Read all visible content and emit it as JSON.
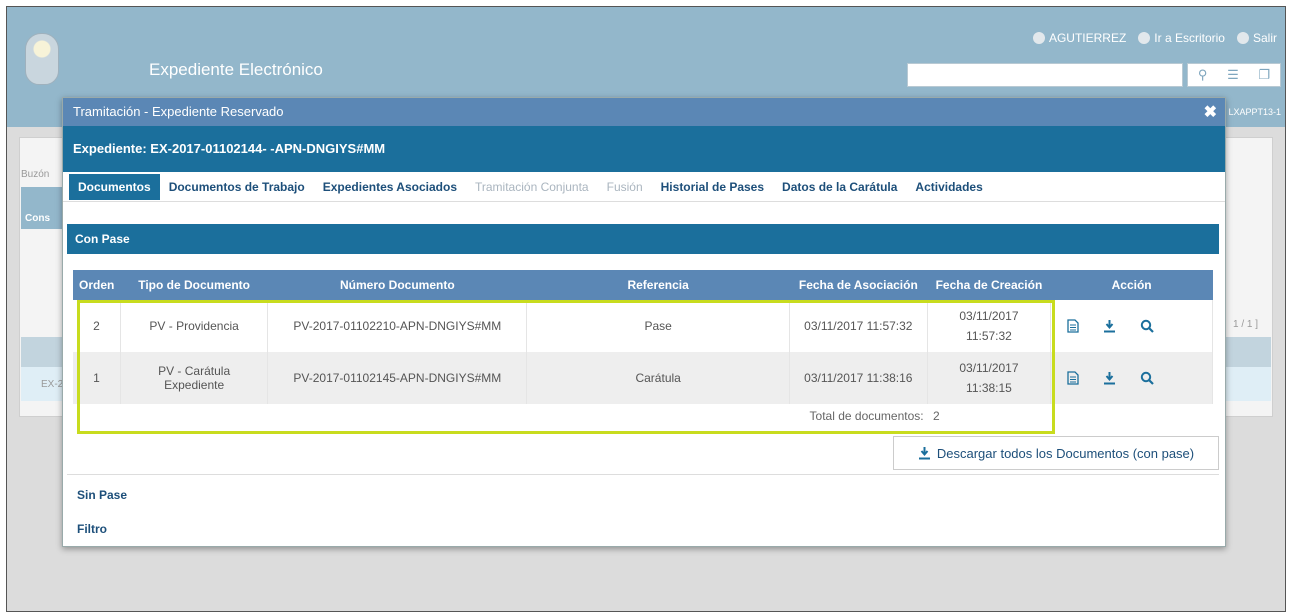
{
  "app": {
    "title": "Expediente Electrónico",
    "user": "AGUTIERREZ",
    "desk_link": "Ir a Escritorio",
    "logout_link": "Salir",
    "code": "LXAPPT13-1"
  },
  "background": {
    "label_buzon": "Buzón",
    "label_cons": "Cons",
    "label_ex": "EX-2",
    "pager": "1 / 1 ]"
  },
  "modal": {
    "title": "Tramitación - Expediente Reservado",
    "expediente": "Expediente: EX-2017-01102144- -APN-DNGIYS#MM",
    "tabs": [
      {
        "label": "Documentos",
        "state": "active"
      },
      {
        "label": "Documentos de Trabajo",
        "state": "normal"
      },
      {
        "label": "Expedientes Asociados",
        "state": "normal"
      },
      {
        "label": "Tramitación Conjunta",
        "state": "disabled"
      },
      {
        "label": "Fusión",
        "state": "disabled"
      },
      {
        "label": "Historial de Pases",
        "state": "normal"
      },
      {
        "label": "Datos de la Carátula",
        "state": "normal"
      },
      {
        "label": "Actividades",
        "state": "normal"
      }
    ],
    "section_title": "Con Pase",
    "table": {
      "headers": [
        "Orden",
        "Tipo de Documento",
        "Número Documento",
        "Referencia",
        "Fecha de Asociación",
        "Fecha de Creación",
        "Acción"
      ],
      "rows": [
        {
          "orden": "2",
          "tipo": "PV - Providencia",
          "numero": "PV-2017-01102210-APN-DNGIYS#MM",
          "referencia": "Pase",
          "fecha_asociacion": "03/11/2017 11:57:32",
          "fecha_creacion_date": "03/11/2017",
          "fecha_creacion_time": "11:57:32"
        },
        {
          "orden": "1",
          "tipo": "PV - Carátula Expediente",
          "numero": "PV-2017-01102145-APN-DNGIYS#MM",
          "referencia": "Carátula",
          "fecha_asociacion": "03/11/2017 11:38:16",
          "fecha_creacion_date": "03/11/2017",
          "fecha_creacion_time": "11:38:15"
        }
      ],
      "total_label": "Total de documentos:",
      "total_value": "2"
    },
    "download_all": "Descargar todos los Documentos (con pase)",
    "sin_pase": "Sin Pase",
    "filtro": "Filtro"
  },
  "colors": {
    "header_bg": "#93b7cb",
    "modal_title_bg": "#5b87b5",
    "primary": "#1b6f9c",
    "highlight": "#c8dc1e"
  }
}
